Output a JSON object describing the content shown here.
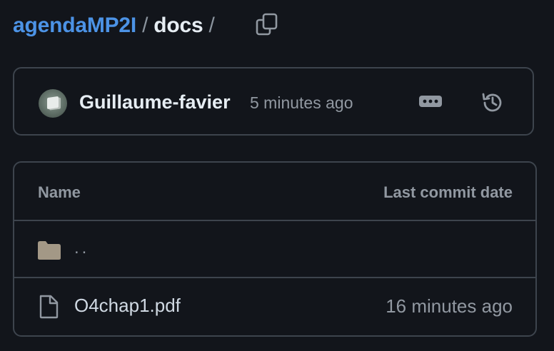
{
  "breadcrumb": {
    "repo": "agendaMP2I",
    "separator": "/",
    "directory": "docs",
    "trailing_separator": "/",
    "copy_icon": "copy-icon"
  },
  "commit": {
    "author": "Guillaume-favier",
    "time": "5 minutes ago",
    "avatar_icon": "avatar",
    "more_icon": "kebab-horizontal-icon",
    "history_icon": "history-icon"
  },
  "table": {
    "headers": {
      "name": "Name",
      "last_commit_date": "Last commit date"
    },
    "parent_row": {
      "label": "..",
      "icon": "folder-icon"
    },
    "files": [
      {
        "name": "O4chap1.pdf",
        "date": "16 minutes ago",
        "icon": "file-icon"
      }
    ]
  },
  "colors": {
    "background": "#12151b",
    "link": "#4c93e6",
    "border": "#3d444d",
    "muted": "#9198a1",
    "text": "#e6edf3"
  }
}
